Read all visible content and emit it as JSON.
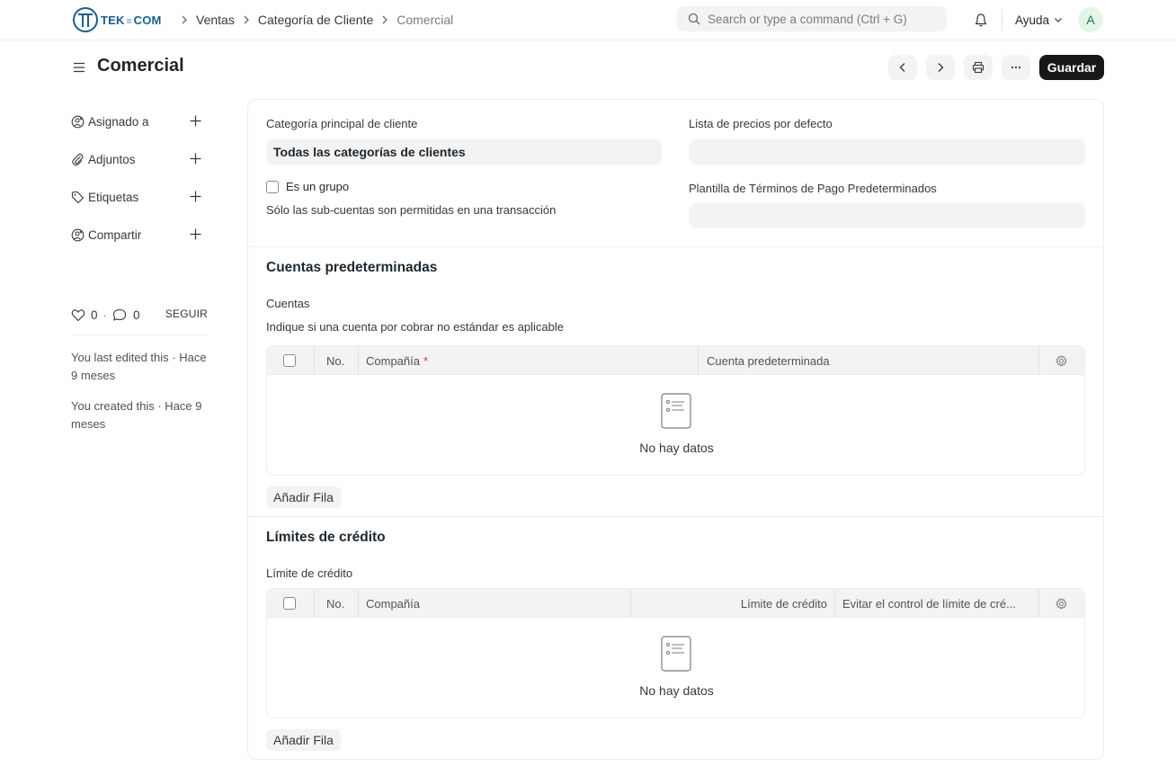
{
  "navbar": {
    "logo_text": "TEK",
    "logo_sep": "=",
    "logo_text2": "COM",
    "breadcrumbs": [
      "Ventas",
      "Categoría de Cliente",
      "Comercial"
    ],
    "search_placeholder": "Search or type a command (Ctrl + G)",
    "help_label": "Ayuda",
    "avatar_letter": "A"
  },
  "page": {
    "title": "Comercial",
    "save_label": "Guardar"
  },
  "sidebar": {
    "items": [
      {
        "label": "Asignado a",
        "icon": "assign-user-icon"
      },
      {
        "label": "Adjuntos",
        "icon": "paperclip-icon"
      },
      {
        "label": "Etiquetas",
        "icon": "tag-icon"
      },
      {
        "label": "Compartir",
        "icon": "share-user-icon"
      }
    ],
    "likes": "0",
    "comments": "0",
    "dot": "·",
    "follow_label": "SEGUIR",
    "last_edited": "You last edited this · Hace 9 meses",
    "created": "You created this · Hace 9 meses"
  },
  "form": {
    "parent_label": "Categoría principal de cliente",
    "parent_value": "Todas las categorías de clientes",
    "is_group_label": "Es un grupo",
    "is_group_desc": "Sólo las sub-cuentas son permitidas en una transacción",
    "price_list_label": "Lista de precios por defecto",
    "payment_terms_label": "Plantilla de Términos de Pago Predeterminados"
  },
  "accounts": {
    "section_title": "Cuentas predeterminadas",
    "table_label": "Cuentas",
    "table_desc": "Indique si una cuenta por cobrar no estándar es aplicable",
    "columns": [
      "No.",
      "Compañía",
      "Cuenta predeterminada"
    ],
    "required_mark": "*",
    "empty_text": "No hay datos",
    "add_row_label": "Añadir Fila"
  },
  "credit": {
    "section_title": "Límites de crédito",
    "table_label": "Límite de crédito",
    "columns": [
      "No.",
      "Compañía",
      "Límite de crédito",
      "Evitar el control de límite de cré..."
    ],
    "empty_text": "No hay datos",
    "add_row_label": "Añadir Fila"
  }
}
